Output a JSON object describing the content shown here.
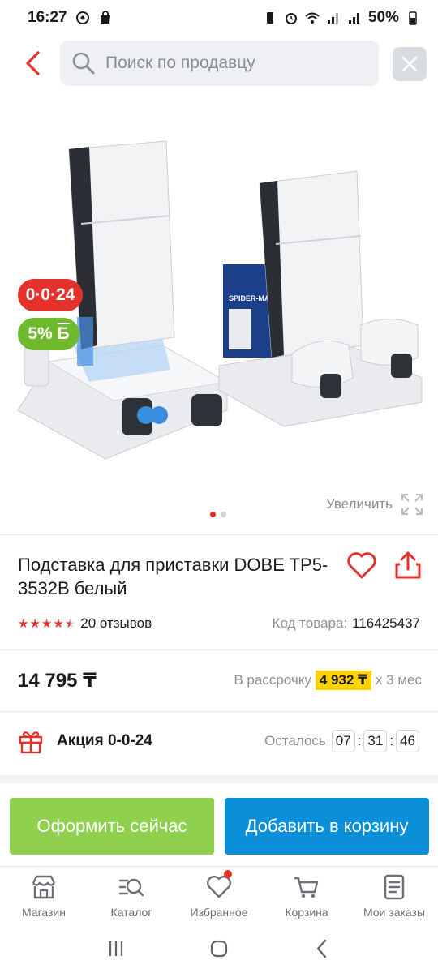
{
  "status_bar": {
    "time": "16:27",
    "battery": "50%"
  },
  "search": {
    "placeholder": "Поиск по продавцу"
  },
  "gallery": {
    "badge_installment": "0·0·24",
    "badge_bonus": "5%",
    "badge_bonus_suffix": "Б",
    "zoom_label": "Увеличить",
    "current_image": 1,
    "image_count": 2
  },
  "product": {
    "title": "Подставка для приставки DOBE TP5-3532B белый",
    "rating": 4.5,
    "reviews": "20 отзывов",
    "code_label": "Код товара:",
    "code_value": "116425437",
    "price": "14 795 ₸",
    "installment_prefix": "В рассрочку",
    "installment_amount": "4 932 ₸",
    "installment_suffix": "x 3 мес"
  },
  "promo": {
    "label": "Акция 0-0-24",
    "remaining_label": "Осталось",
    "hours": "07",
    "minutes": "31",
    "seconds": "46"
  },
  "actions": {
    "buy_now": "Оформить сейчас",
    "add_to_cart": "Добавить в корзину"
  },
  "bottom_nav": {
    "items": [
      {
        "label": "Магазин",
        "icon": "store-icon"
      },
      {
        "label": "Каталог",
        "icon": "catalog-search-icon"
      },
      {
        "label": "Избранное",
        "icon": "heart-icon"
      },
      {
        "label": "Корзина",
        "icon": "cart-icon"
      },
      {
        "label": "Мои заказы",
        "icon": "orders-icon"
      }
    ]
  },
  "colors": {
    "accent_red": "#e4312b",
    "buy_green": "#8fd14f",
    "cart_blue": "#0a8fd8",
    "installment_yellow": "#ffd200",
    "bonus_green": "#6fba2c"
  }
}
